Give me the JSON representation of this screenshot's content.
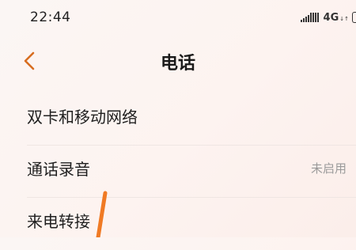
{
  "status_bar": {
    "time": "22:44",
    "network": "4G",
    "network_arrows": "↓↑",
    "icons": [
      "signal-icon",
      "battery-icon"
    ]
  },
  "header": {
    "back_icon": "chevron-left-icon",
    "title": "电话"
  },
  "settings": [
    {
      "label": "双卡和移动网络",
      "value": ""
    },
    {
      "label": "通话录音",
      "value": "未启用"
    },
    {
      "label": "来电转接",
      "value": ""
    }
  ],
  "colors": {
    "accent": "#d86d20",
    "annotation": "#f07a24",
    "secondary_text": "#9a9a9a"
  }
}
